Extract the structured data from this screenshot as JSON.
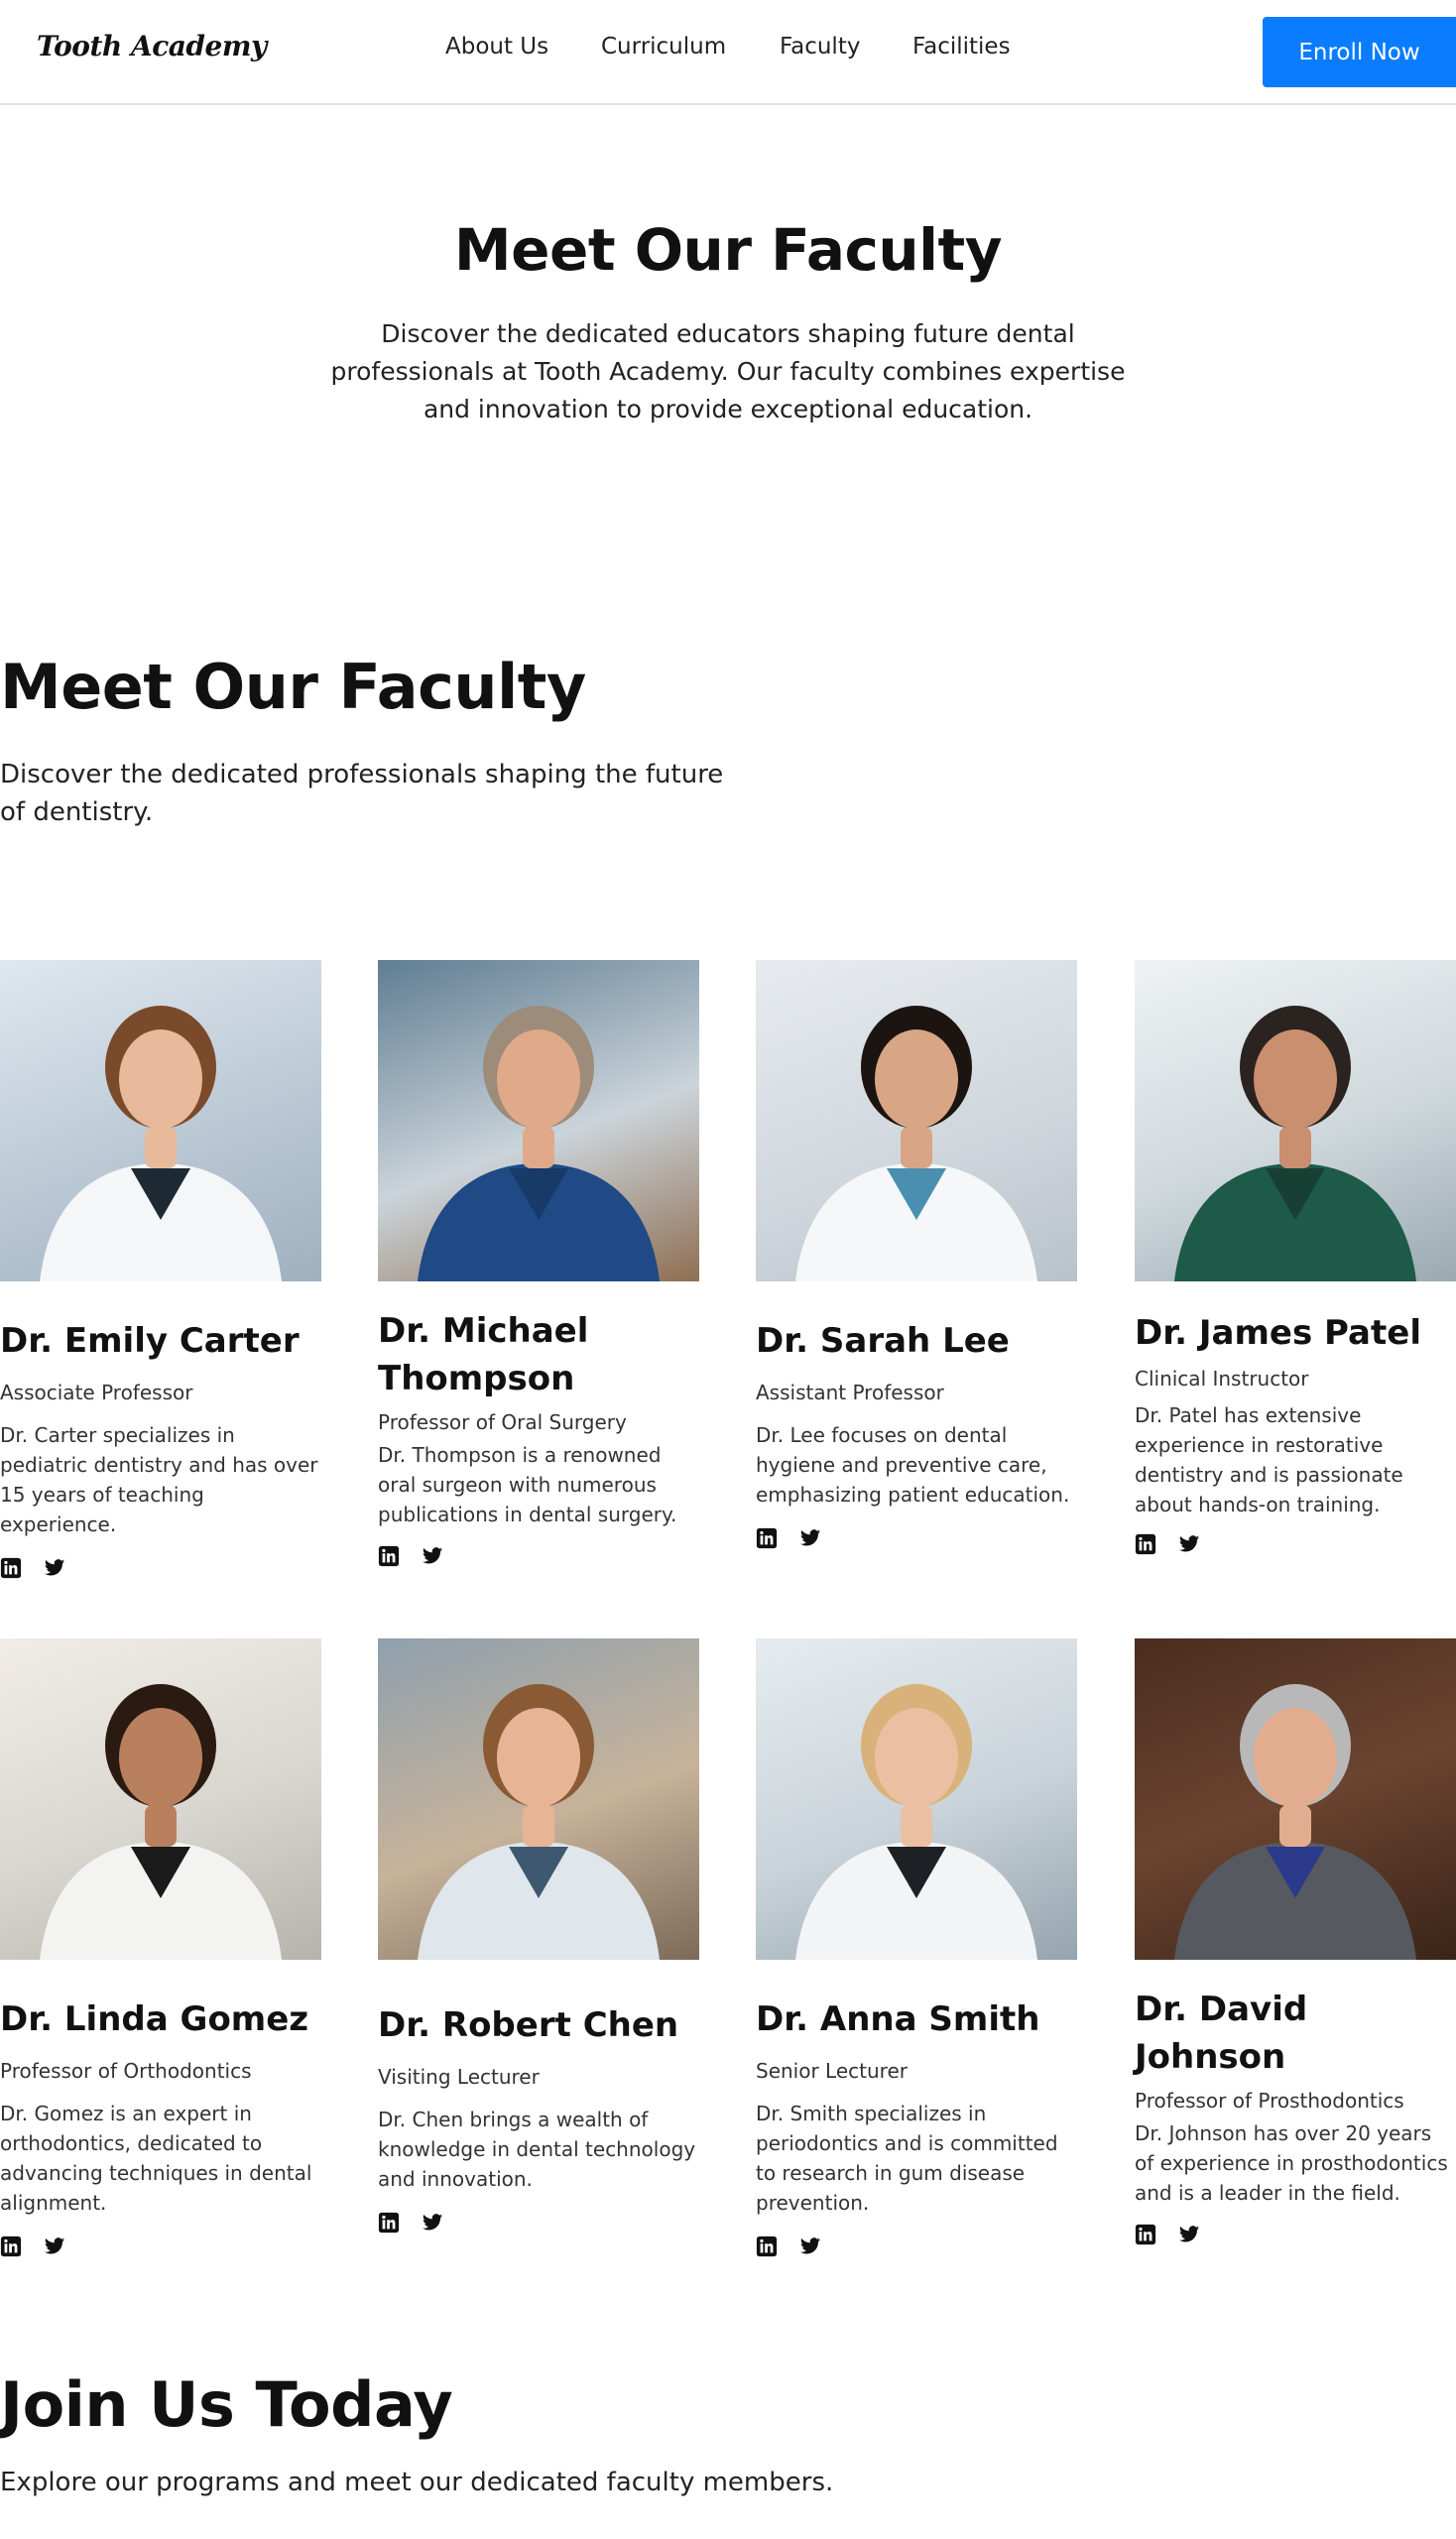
{
  "header": {
    "logo": "Tooth Academy",
    "nav": [
      "About Us",
      "Curriculum",
      "Faculty",
      "Facilities"
    ],
    "cta": "Enroll Now"
  },
  "hero": {
    "title": "Meet Our Faculty",
    "text": "Discover the dedicated educators shaping future dental professionals at Tooth Academy. Our faculty combines expertise and innovation to provide exceptional education."
  },
  "faculty": {
    "title": "Meet Our Faculty",
    "text": "Discover the dedicated professionals shaping the future of dentistry.",
    "members": [
      {
        "name": "Dr. Emily Carter",
        "role": "Associate Professor",
        "bio": "Dr. Carter specializes in pediatric dentistry and has over 15 years of teaching experience."
      },
      {
        "name": "Dr. Michael Thompson",
        "role": "Professor of Oral Surgery",
        "bio": "Dr. Thompson is a renowned oral surgeon with numerous publications in dental surgery."
      },
      {
        "name": "Dr. Sarah Lee",
        "role": "Assistant Professor",
        "bio": "Dr. Lee focuses on dental hygiene and preventive care, emphasizing patient education."
      },
      {
        "name": "Dr. James Patel",
        "role": "Clinical Instructor",
        "bio": "Dr. Patel has extensive experience in restorative dentistry and is passionate about hands-on training."
      },
      {
        "name": "Dr. Linda Gomez",
        "role": "Professor of Orthodontics",
        "bio": "Dr. Gomez is an expert in orthodontics, dedicated to advancing techniques in dental alignment."
      },
      {
        "name": "Dr. Robert Chen",
        "role": "Visiting Lecturer",
        "bio": "Dr. Chen brings a wealth of knowledge in dental technology and innovation."
      },
      {
        "name": "Dr. Anna Smith",
        "role": "Senior Lecturer",
        "bio": "Dr. Smith specializes in periodontics and is committed to research in gum disease prevention."
      },
      {
        "name": "Dr. David Johnson",
        "role": "Professor of Prosthodontics",
        "bio": "Dr. Johnson has over 20 years of experience in prosthodontics and is a leader in the field."
      }
    ]
  },
  "join": {
    "title": "Join Us Today",
    "text": "Explore our programs and meet our dedicated faculty members."
  },
  "social_icons": [
    "linkedin-icon",
    "twitter-icon"
  ],
  "colors": {
    "accent": "#0a7cff"
  }
}
